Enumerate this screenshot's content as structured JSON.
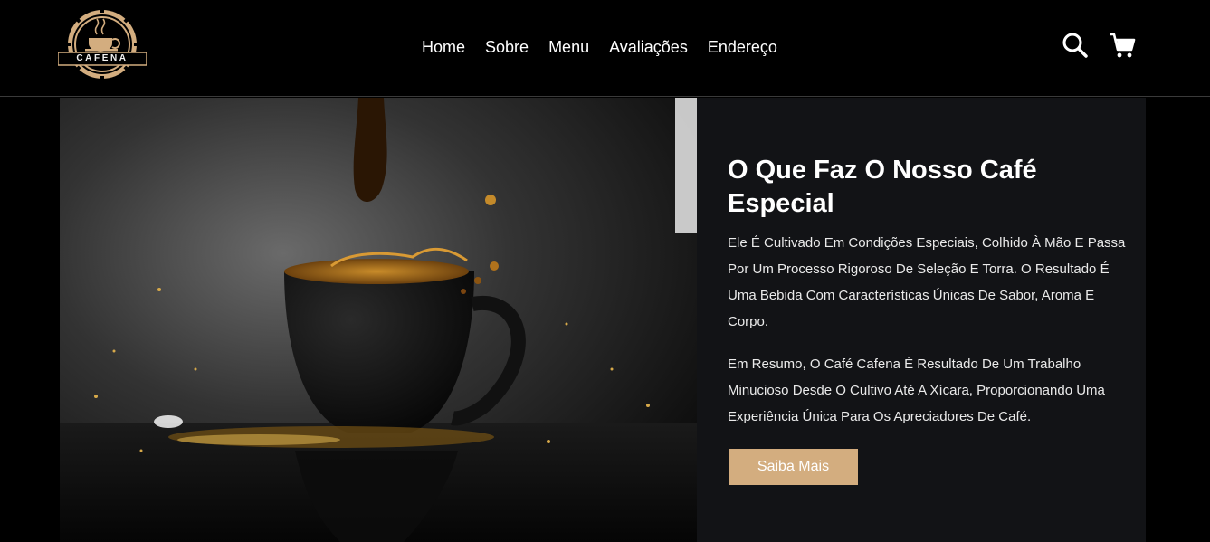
{
  "brand": {
    "logo_text": "CAFENA"
  },
  "nav": {
    "items": [
      {
        "label": "Home"
      },
      {
        "label": "Sobre"
      },
      {
        "label": "Menu"
      },
      {
        "label": "Avaliações"
      },
      {
        "label": "Endereço"
      }
    ]
  },
  "header_icons": {
    "search": "search-icon",
    "cart": "cart-icon"
  },
  "about": {
    "title": "O Que Faz O Nosso Café Especial",
    "paragraph_1": "Ele É Cultivado Em Condições Especiais, Colhido À Mão E Passa Por Um Processo Rigoroso De Seleção E Torra. O Resultado É Uma Bebida Com Características Únicas De Sabor, Aroma E Corpo.",
    "paragraph_2": "Em Resumo, O Café Cafena É Resultado De Um Trabalho Minucioso Desde O Cultivo Até A Xícara, Proporcionando Uma Experiência Única Para Os Apreciadores De Café.",
    "button_label": "Saiba Mais"
  },
  "colors": {
    "accent": "#d3ad7f",
    "page_bg": "#000000",
    "panel_bg": "#121316"
  }
}
